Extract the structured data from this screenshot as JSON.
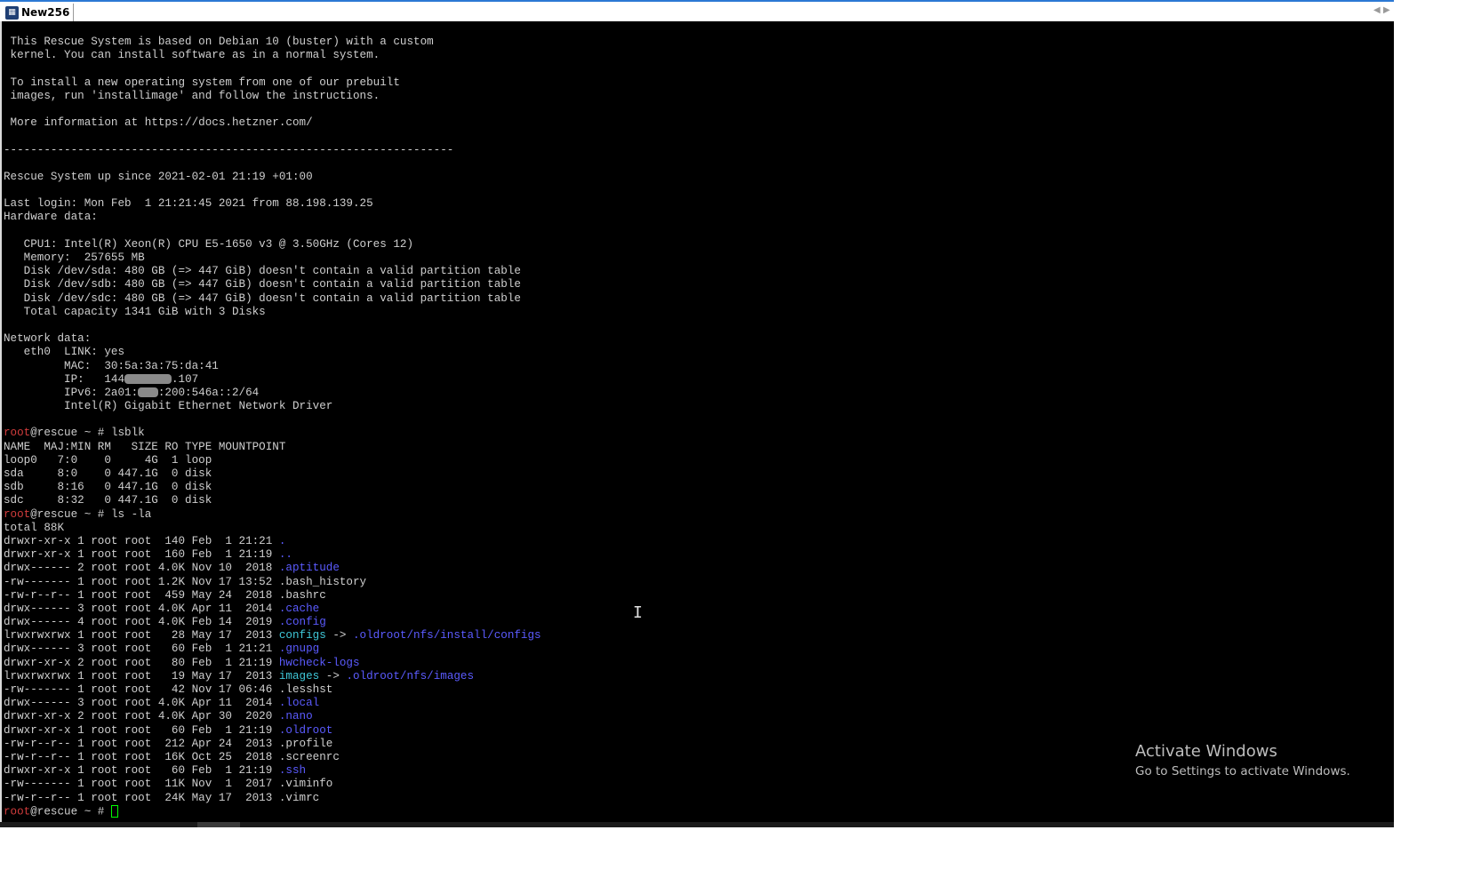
{
  "window": {
    "title": "New256",
    "icon": "putty-terminal-icon"
  },
  "colors": {
    "terminal_bg": "#000000",
    "text": "#cfcfcf",
    "prompt_user": "#d13c3c",
    "directory": "#5b5bff",
    "symlink": "#3fc7d8",
    "cursor": "#00ff00"
  },
  "terminal": {
    "lines": [
      " This Rescue System is based on Debian 10 (buster) with a custom",
      " kernel. You can install software as in a normal system.",
      "",
      " To install a new operating system from one of our prebuilt",
      " images, run 'installimage' and follow the instructions.",
      "",
      " More information at https://docs.hetzner.com/",
      "",
      "-------------------------------------------------------------------",
      "",
      "Rescue System up since 2021-02-01 21:19 +01:00",
      "",
      "Last login: Mon Feb  1 21:21:45 2021 from 88.198.139.25",
      "Hardware data:",
      "",
      "   CPU1: Intel(R) Xeon(R) CPU E5-1650 v3 @ 3.50GHz (Cores 12)",
      "   Memory:  257655 MB",
      "   Disk /dev/sda: 480 GB (=> 447 GiB) doesn't contain a valid partition table",
      "   Disk /dev/sdb: 480 GB (=> 447 GiB) doesn't contain a valid partition table",
      "   Disk /dev/sdc: 480 GB (=> 447 GiB) doesn't contain a valid partition table",
      "   Total capacity 1341 GiB with 3 Disks",
      "",
      "Network data:",
      "   eth0  LINK: yes",
      "         MAC:  30:5a:3a:75:da:41",
      {
        "text": "         IP:   144",
        "redact": 7,
        "after": ".107"
      },
      {
        "text": "         IPv6: 2a01:",
        "redact": 3,
        "after": ":200:546a::2/64"
      },
      "         Intel(R) Gigabit Ethernet Network Driver",
      "",
      {
        "prompt": true,
        "cmd": "lsblk"
      },
      "NAME  MAJ:MIN RM   SIZE RO TYPE MOUNTPOINT",
      "loop0   7:0    0     4G  1 loop",
      "sda     8:0    0 447.1G  0 disk",
      "sdb     8:16   0 447.1G  0 disk",
      "sdc     8:32   0 447.1G  0 disk",
      {
        "prompt": true,
        "cmd": "ls -la"
      },
      "total 88K",
      {
        "meta": "drwxr-xr-x 1 root root  140 Feb  1 21:21",
        "name": ".",
        "kind": "dir"
      },
      {
        "meta": "drwxr-xr-x 1 root root  160 Feb  1 21:19",
        "name": "..",
        "kind": "dir"
      },
      {
        "meta": "drwx------ 2 root root 4.0K Nov 10  2018",
        "name": ".aptitude",
        "kind": "dir"
      },
      {
        "meta": "-rw------- 1 root root 1.2K Nov 17 13:52",
        "name": ".bash_history",
        "kind": "file"
      },
      {
        "meta": "-rw-r--r-- 1 root root  459 May 24  2018",
        "name": ".bashrc",
        "kind": "file"
      },
      {
        "meta": "drwx------ 3 root root 4.0K Apr 11  2014",
        "name": ".cache",
        "kind": "dir"
      },
      {
        "meta": "drwx------ 4 root root 4.0K Feb 14  2019",
        "name": ".config",
        "kind": "dir"
      },
      {
        "meta": "lrwxrwxrwx 1 root root   28 May 17  2013",
        "name": "configs",
        "kind": "link",
        "target": ".oldroot/nfs/install/configs"
      },
      {
        "meta": "drwx------ 3 root root   60 Feb  1 21:21",
        "name": ".gnupg",
        "kind": "dir"
      },
      {
        "meta": "drwxr-xr-x 2 root root   80 Feb  1 21:19",
        "name": "hwcheck-logs",
        "kind": "dir"
      },
      {
        "meta": "lrwxrwxrwx 1 root root   19 May 17  2013",
        "name": "images",
        "kind": "link",
        "target": ".oldroot/nfs/images"
      },
      {
        "meta": "-rw------- 1 root root   42 Nov 17 06:46",
        "name": ".lesshst",
        "kind": "file"
      },
      {
        "meta": "drwx------ 3 root root 4.0K Apr 11  2014",
        "name": ".local",
        "kind": "dir"
      },
      {
        "meta": "drwxr-xr-x 2 root root 4.0K Apr 30  2020",
        "name": ".nano",
        "kind": "dir"
      },
      {
        "meta": "drwxr-xr-x 1 root root   60 Feb  1 21:19",
        "name": ".oldroot",
        "kind": "dir"
      },
      {
        "meta": "-rw-r--r-- 1 root root  212 Apr 24  2013",
        "name": ".profile",
        "kind": "file"
      },
      {
        "meta": "-rw-r--r-- 1 root root  16K Oct 25  2018",
        "name": ".screenrc",
        "kind": "file"
      },
      {
        "meta": "drwxr-xr-x 1 root root   60 Feb  1 21:19",
        "name": ".ssh",
        "kind": "dir"
      },
      {
        "meta": "-rw------- 1 root root  11K Nov  1  2017",
        "name": ".viminfo",
        "kind": "file"
      },
      {
        "meta": "-rw-r--r-- 1 root root  24K May 17  2013",
        "name": ".vimrc",
        "kind": "file"
      },
      {
        "prompt": true,
        "cmd": "",
        "cursor": true
      }
    ],
    "prompt": {
      "user": "root",
      "host": "@rescue ~ # "
    },
    "link_arrow": " -> "
  },
  "watermark": {
    "title": "Activate Windows",
    "subtitle": "Go to Settings to activate Windows."
  }
}
